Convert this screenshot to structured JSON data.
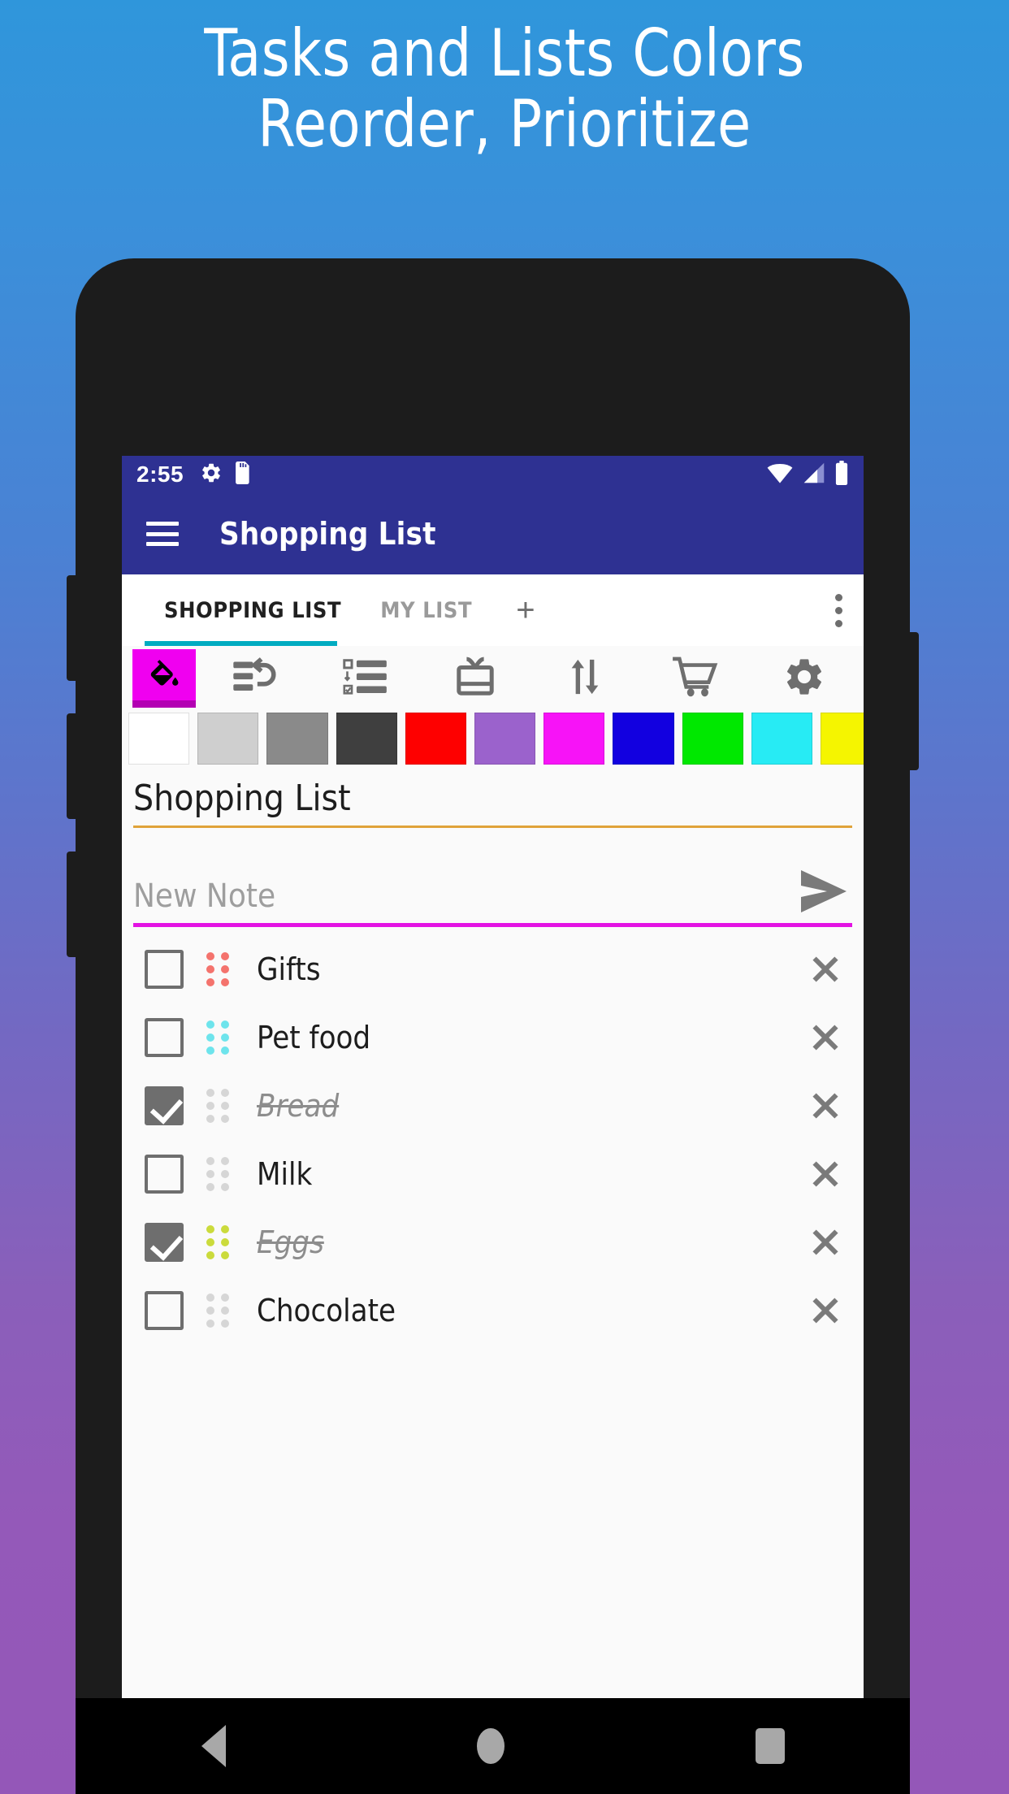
{
  "headline": {
    "line1": "Tasks and Lists Colors",
    "line2": "Reorder, Prioritize"
  },
  "statusbar": {
    "time": "2:55",
    "icons": [
      "gear-icon",
      "sdcard-icon",
      "wifi-icon",
      "signal-icon",
      "battery-icon"
    ]
  },
  "appbar": {
    "menu_icon": "hamburger-menu-icon",
    "title": "Shopping List"
  },
  "tabs": {
    "items": [
      {
        "label": "SHOPPING LIST",
        "active": true
      },
      {
        "label": "MY LIST",
        "active": false
      }
    ],
    "add_label": "+",
    "overflow_icon": "more-vertical-icon",
    "active_indicator_color": "#00acc1"
  },
  "toolbar": {
    "items": [
      {
        "name": "paint-bucket-icon",
        "highlight_color": "#f000f0"
      },
      {
        "name": "undo-list-icon"
      },
      {
        "name": "checklist-icon"
      },
      {
        "name": "gift-icon"
      },
      {
        "name": "sort-arrows-icon"
      },
      {
        "name": "shopping-cart-icon"
      },
      {
        "name": "settings-gear-icon"
      }
    ]
  },
  "palette": {
    "colors": [
      "#ffffff",
      "#cfcfcf",
      "#8a8a8a",
      "#3f3f3f",
      "#fe0000",
      "#9b62cc",
      "#f713f7",
      "#1200e0",
      "#00e800",
      "#27ebf4",
      "#f5f500"
    ]
  },
  "list_title": {
    "value": "Shopping List",
    "underline_color": "#e0a33a"
  },
  "new_note": {
    "placeholder": "New Note",
    "value": "",
    "send_icon": "send-arrow-icon",
    "underline_color": "#e313e3"
  },
  "items": [
    {
      "label": "Gifts",
      "checked": false,
      "dot_color": "#f4736d"
    },
    {
      "label": "Pet food",
      "checked": false,
      "dot_color": "#6ee4ec"
    },
    {
      "label": "Bread",
      "checked": true,
      "dot_color": "#d6d6d6"
    },
    {
      "label": "Milk",
      "checked": false,
      "dot_color": "#d6d6d6"
    },
    {
      "label": "Eggs",
      "checked": true,
      "dot_color": "#cbdb3c"
    },
    {
      "label": "Chocolate",
      "checked": false,
      "dot_color": "#d6d6d6"
    }
  ],
  "navbar": {
    "back": "back-triangle-icon",
    "home": "home-circle-icon",
    "recents": "recents-square-icon"
  }
}
